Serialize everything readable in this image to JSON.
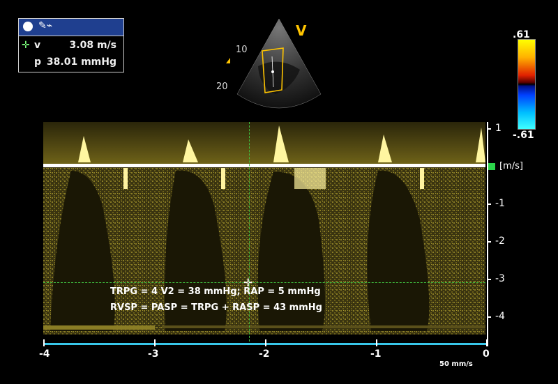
{
  "measurement_box": {
    "tool_icon": "ruler-icon",
    "velocity_label": "v",
    "velocity_value": "3.08 m/s",
    "pressure_label": "p",
    "pressure_value": "38.01 mmHg"
  },
  "sector": {
    "mode_marker": "V",
    "depth_10": "10",
    "depth_20": "20"
  },
  "color_bar": {
    "top_label": ".61",
    "bottom_label": "-.61"
  },
  "velocity_axis": {
    "labels": [
      "1",
      "-1",
      "-2",
      "-3",
      "-4"
    ],
    "unit": "[m/s]"
  },
  "time_axis": {
    "labels": [
      "-4",
      "-3",
      "-2",
      "-1",
      "0"
    ],
    "sweep_speed": "50 mm/s"
  },
  "annotation": {
    "line1": "TRPG = 4 V2 = 38 mmHg; RAP = 5 mmHg",
    "line2": "RVSP = PASP = TRPG + RASP = 43 mmHg"
  },
  "colors": {
    "doppler": "#ffe94a",
    "axis": "#38c6e8",
    "cursor": "#3fbf3f",
    "header": "#1f3f8f"
  }
}
